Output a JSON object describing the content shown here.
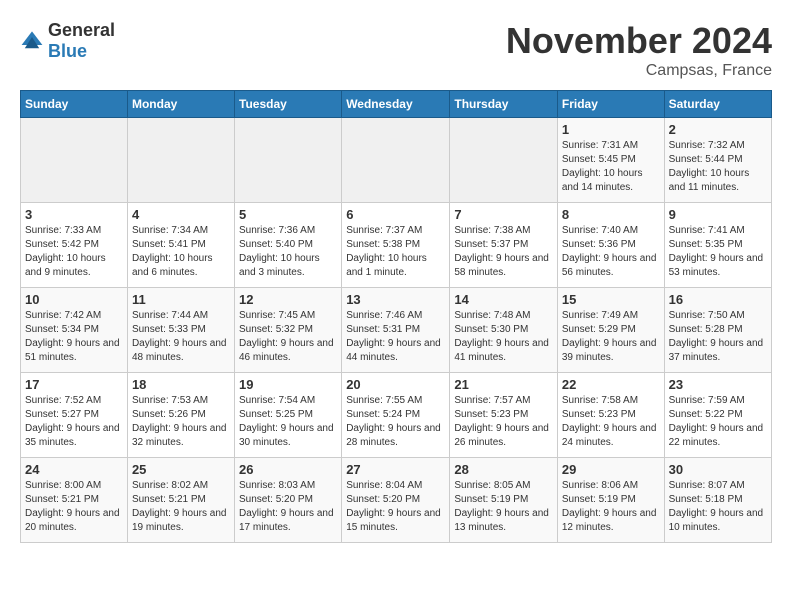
{
  "logo": {
    "text_general": "General",
    "text_blue": "Blue"
  },
  "header": {
    "month": "November 2024",
    "location": "Campsas, France"
  },
  "weekdays": [
    "Sunday",
    "Monday",
    "Tuesday",
    "Wednesday",
    "Thursday",
    "Friday",
    "Saturday"
  ],
  "weeks": [
    [
      {
        "day": "",
        "info": ""
      },
      {
        "day": "",
        "info": ""
      },
      {
        "day": "",
        "info": ""
      },
      {
        "day": "",
        "info": ""
      },
      {
        "day": "",
        "info": ""
      },
      {
        "day": "1",
        "info": "Sunrise: 7:31 AM\nSunset: 5:45 PM\nDaylight: 10 hours and 14 minutes."
      },
      {
        "day": "2",
        "info": "Sunrise: 7:32 AM\nSunset: 5:44 PM\nDaylight: 10 hours and 11 minutes."
      }
    ],
    [
      {
        "day": "3",
        "info": "Sunrise: 7:33 AM\nSunset: 5:42 PM\nDaylight: 10 hours and 9 minutes."
      },
      {
        "day": "4",
        "info": "Sunrise: 7:34 AM\nSunset: 5:41 PM\nDaylight: 10 hours and 6 minutes."
      },
      {
        "day": "5",
        "info": "Sunrise: 7:36 AM\nSunset: 5:40 PM\nDaylight: 10 hours and 3 minutes."
      },
      {
        "day": "6",
        "info": "Sunrise: 7:37 AM\nSunset: 5:38 PM\nDaylight: 10 hours and 1 minute."
      },
      {
        "day": "7",
        "info": "Sunrise: 7:38 AM\nSunset: 5:37 PM\nDaylight: 9 hours and 58 minutes."
      },
      {
        "day": "8",
        "info": "Sunrise: 7:40 AM\nSunset: 5:36 PM\nDaylight: 9 hours and 56 minutes."
      },
      {
        "day": "9",
        "info": "Sunrise: 7:41 AM\nSunset: 5:35 PM\nDaylight: 9 hours and 53 minutes."
      }
    ],
    [
      {
        "day": "10",
        "info": "Sunrise: 7:42 AM\nSunset: 5:34 PM\nDaylight: 9 hours and 51 minutes."
      },
      {
        "day": "11",
        "info": "Sunrise: 7:44 AM\nSunset: 5:33 PM\nDaylight: 9 hours and 48 minutes."
      },
      {
        "day": "12",
        "info": "Sunrise: 7:45 AM\nSunset: 5:32 PM\nDaylight: 9 hours and 46 minutes."
      },
      {
        "day": "13",
        "info": "Sunrise: 7:46 AM\nSunset: 5:31 PM\nDaylight: 9 hours and 44 minutes."
      },
      {
        "day": "14",
        "info": "Sunrise: 7:48 AM\nSunset: 5:30 PM\nDaylight: 9 hours and 41 minutes."
      },
      {
        "day": "15",
        "info": "Sunrise: 7:49 AM\nSunset: 5:29 PM\nDaylight: 9 hours and 39 minutes."
      },
      {
        "day": "16",
        "info": "Sunrise: 7:50 AM\nSunset: 5:28 PM\nDaylight: 9 hours and 37 minutes."
      }
    ],
    [
      {
        "day": "17",
        "info": "Sunrise: 7:52 AM\nSunset: 5:27 PM\nDaylight: 9 hours and 35 minutes."
      },
      {
        "day": "18",
        "info": "Sunrise: 7:53 AM\nSunset: 5:26 PM\nDaylight: 9 hours and 32 minutes."
      },
      {
        "day": "19",
        "info": "Sunrise: 7:54 AM\nSunset: 5:25 PM\nDaylight: 9 hours and 30 minutes."
      },
      {
        "day": "20",
        "info": "Sunrise: 7:55 AM\nSunset: 5:24 PM\nDaylight: 9 hours and 28 minutes."
      },
      {
        "day": "21",
        "info": "Sunrise: 7:57 AM\nSunset: 5:23 PM\nDaylight: 9 hours and 26 minutes."
      },
      {
        "day": "22",
        "info": "Sunrise: 7:58 AM\nSunset: 5:23 PM\nDaylight: 9 hours and 24 minutes."
      },
      {
        "day": "23",
        "info": "Sunrise: 7:59 AM\nSunset: 5:22 PM\nDaylight: 9 hours and 22 minutes."
      }
    ],
    [
      {
        "day": "24",
        "info": "Sunrise: 8:00 AM\nSunset: 5:21 PM\nDaylight: 9 hours and 20 minutes."
      },
      {
        "day": "25",
        "info": "Sunrise: 8:02 AM\nSunset: 5:21 PM\nDaylight: 9 hours and 19 minutes."
      },
      {
        "day": "26",
        "info": "Sunrise: 8:03 AM\nSunset: 5:20 PM\nDaylight: 9 hours and 17 minutes."
      },
      {
        "day": "27",
        "info": "Sunrise: 8:04 AM\nSunset: 5:20 PM\nDaylight: 9 hours and 15 minutes."
      },
      {
        "day": "28",
        "info": "Sunrise: 8:05 AM\nSunset: 5:19 PM\nDaylight: 9 hours and 13 minutes."
      },
      {
        "day": "29",
        "info": "Sunrise: 8:06 AM\nSunset: 5:19 PM\nDaylight: 9 hours and 12 minutes."
      },
      {
        "day": "30",
        "info": "Sunrise: 8:07 AM\nSunset: 5:18 PM\nDaylight: 9 hours and 10 minutes."
      }
    ]
  ]
}
